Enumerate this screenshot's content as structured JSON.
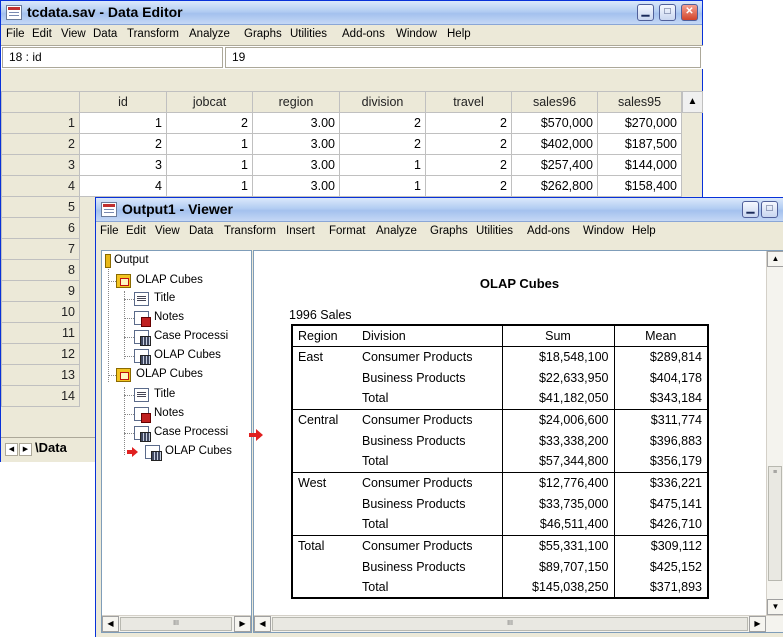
{
  "editor": {
    "title": "tcdata.sav - Data Editor",
    "menu": [
      "File",
      "Edit",
      "View",
      "Data",
      "Transform",
      "Analyze",
      "Graphs",
      "Utilities",
      "Add-ons",
      "Window",
      "Help"
    ],
    "cell_ref": "18 : id",
    "cell_value": "19",
    "columns": [
      "id",
      "jobcat",
      "region",
      "division",
      "travel",
      "sales96",
      "sales95"
    ],
    "rows": [
      {
        "n": "1",
        "cells": [
          "1",
          "2",
          "3.00",
          "2",
          "2",
          "$570,000",
          "$270,000"
        ]
      },
      {
        "n": "2",
        "cells": [
          "2",
          "1",
          "3.00",
          "2",
          "2",
          "$402,000",
          "$187,500"
        ]
      },
      {
        "n": "3",
        "cells": [
          "3",
          "1",
          "3.00",
          "1",
          "2",
          "$257,400",
          "$144,000"
        ]
      },
      {
        "n": "4",
        "cells": [
          "4",
          "1",
          "3.00",
          "1",
          "2",
          "$262,800",
          "$158,400"
        ]
      }
    ],
    "row_numbers": [
      "5",
      "6",
      "7",
      "8",
      "9",
      "10",
      "11",
      "12",
      "13",
      "14"
    ],
    "sheet_tab": "Data"
  },
  "viewer": {
    "title": "Output1 - Viewer",
    "menu": [
      "File",
      "Edit",
      "View",
      "Data",
      "Transform",
      "Insert",
      "Format",
      "Analyze",
      "Graphs",
      "Utilities",
      "Add-ons",
      "Window",
      "Help"
    ],
    "tree": {
      "root": "Output",
      "group1": "OLAP Cubes",
      "group1_items": [
        "Title",
        "Notes",
        "Case Processi",
        "OLAP Cubes"
      ],
      "group2": "OLAP Cubes",
      "group2_items": [
        "Title",
        "Notes",
        "Case Processi",
        "OLAP Cubes"
      ]
    },
    "table_title": "OLAP Cubes",
    "layer": "1996 Sales",
    "headers": {
      "region": "Region",
      "division": "Division",
      "sum": "Sum",
      "mean": "Mean"
    },
    "groups": [
      {
        "region": "East",
        "rows": [
          {
            "division": "Consumer Products",
            "sum": "$18,548,100",
            "mean": "$289,814"
          },
          {
            "division": "Business Products",
            "sum": "$22,633,950",
            "mean": "$404,178"
          },
          {
            "division": "Total",
            "sum": "$41,182,050",
            "mean": "$343,184"
          }
        ]
      },
      {
        "region": "Central",
        "rows": [
          {
            "division": "Consumer Products",
            "sum": "$24,006,600",
            "mean": "$311,774"
          },
          {
            "division": "Business Products",
            "sum": "$33,338,200",
            "mean": "$396,883"
          },
          {
            "division": "Total",
            "sum": "$57,344,800",
            "mean": "$356,179"
          }
        ]
      },
      {
        "region": "West",
        "rows": [
          {
            "division": "Consumer Products",
            "sum": "$12,776,400",
            "mean": "$336,221"
          },
          {
            "division": "Business Products",
            "sum": "$33,735,000",
            "mean": "$475,141"
          },
          {
            "division": "Total",
            "sum": "$46,511,400",
            "mean": "$426,710"
          }
        ]
      },
      {
        "region": "Total",
        "rows": [
          {
            "division": "Consumer Products",
            "sum": "$55,331,100",
            "mean": "$309,112"
          },
          {
            "division": "Business Products",
            "sum": "$89,707,150",
            "mean": "$425,152"
          },
          {
            "division": "Total",
            "sum": "$145,038,250",
            "mean": "$371,893"
          }
        ]
      }
    ]
  },
  "icons": {
    "window_controls": [
      "minimize-icon",
      "maximize-icon",
      "close-icon"
    ],
    "tree": [
      "output-icon",
      "book-icon",
      "title-doc-icon",
      "notes-icon",
      "table-icon"
    ],
    "current_item": "red-arrow-icon"
  },
  "colors": {
    "titlebar": "#b3cdf2",
    "window_bg": "#ece9d8",
    "current_arrow": "#e02020"
  }
}
